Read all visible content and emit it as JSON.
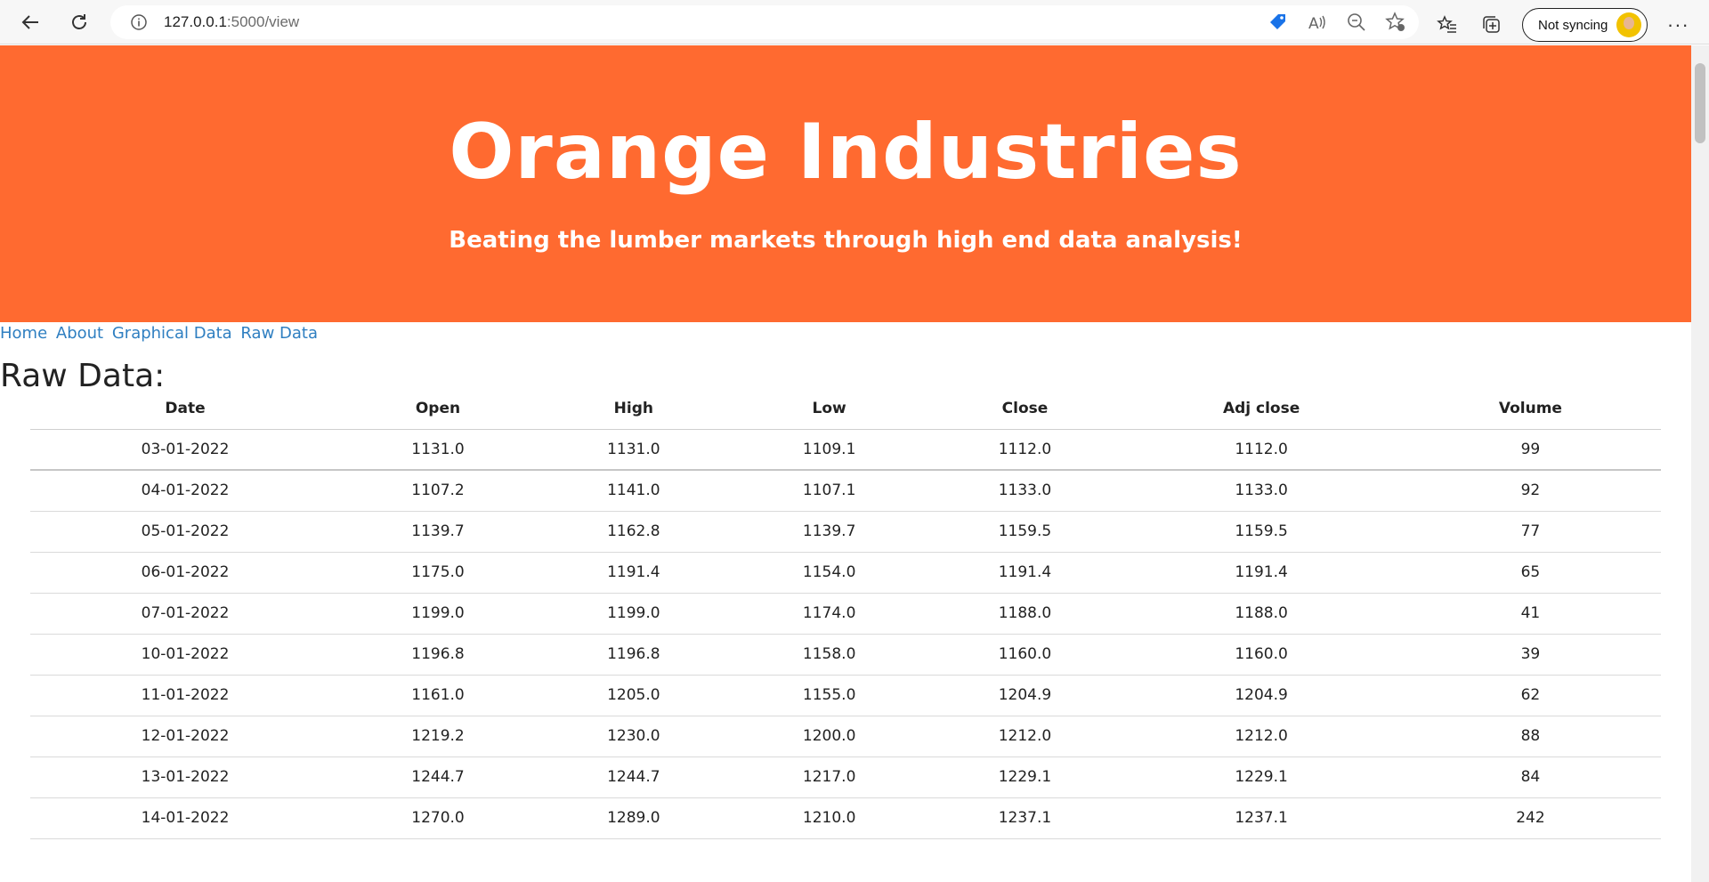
{
  "browser": {
    "url_host": "127.0.0.1",
    "url_path": ":5000/view",
    "sync_label": "Not syncing"
  },
  "hero": {
    "title": "Orange Industries",
    "subtitle": "Beating the lumber markets through high end data analysis!",
    "background": "#ff6a30"
  },
  "nav": {
    "links": [
      "Home",
      "About",
      "Graphical Data",
      "Raw Data"
    ]
  },
  "section": {
    "title": "Raw Data:"
  },
  "table": {
    "headers": [
      "Date",
      "Open",
      "High",
      "Low",
      "Close",
      "Adj close",
      "Volume"
    ],
    "rows": [
      [
        "03-01-2022",
        "1131.0",
        "1131.0",
        "1109.1",
        "1112.0",
        "1112.0",
        "99"
      ],
      [
        "04-01-2022",
        "1107.2",
        "1141.0",
        "1107.1",
        "1133.0",
        "1133.0",
        "92"
      ],
      [
        "05-01-2022",
        "1139.7",
        "1162.8",
        "1139.7",
        "1159.5",
        "1159.5",
        "77"
      ],
      [
        "06-01-2022",
        "1175.0",
        "1191.4",
        "1154.0",
        "1191.4",
        "1191.4",
        "65"
      ],
      [
        "07-01-2022",
        "1199.0",
        "1199.0",
        "1174.0",
        "1188.0",
        "1188.0",
        "41"
      ],
      [
        "10-01-2022",
        "1196.8",
        "1196.8",
        "1158.0",
        "1160.0",
        "1160.0",
        "39"
      ],
      [
        "11-01-2022",
        "1161.0",
        "1205.0",
        "1155.0",
        "1204.9",
        "1204.9",
        "62"
      ],
      [
        "12-01-2022",
        "1219.2",
        "1230.0",
        "1200.0",
        "1212.0",
        "1212.0",
        "88"
      ],
      [
        "13-01-2022",
        "1244.7",
        "1244.7",
        "1217.0",
        "1229.1",
        "1229.1",
        "84"
      ],
      [
        "14-01-2022",
        "1270.0",
        "1289.0",
        "1210.0",
        "1237.1",
        "1237.1",
        "242"
      ]
    ]
  }
}
